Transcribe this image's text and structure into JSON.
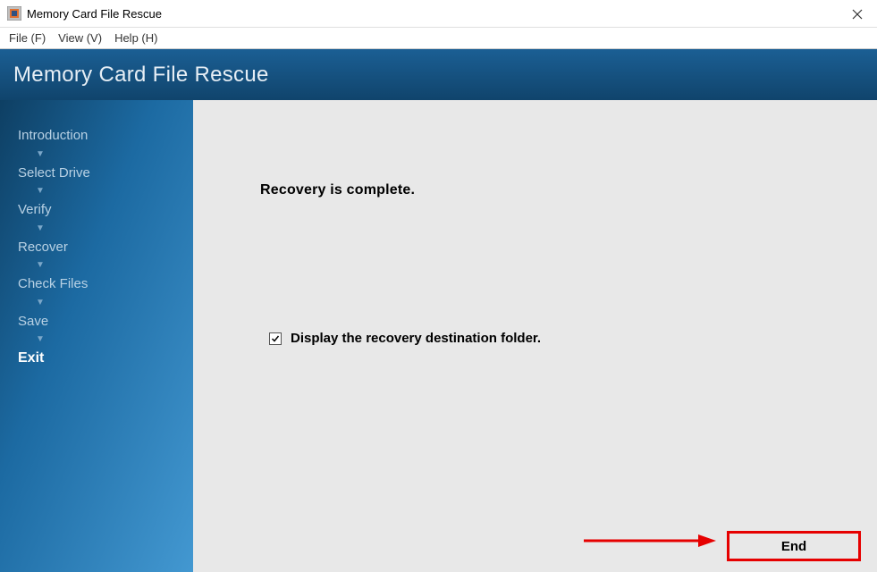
{
  "window": {
    "title": "Memory Card File Rescue"
  },
  "menu": {
    "items": [
      "File (F)",
      "View (V)",
      "Help (H)"
    ]
  },
  "header": {
    "title": "Memory Card File Rescue"
  },
  "sidebar": {
    "steps": [
      "Introduction",
      "Select Drive",
      "Verify",
      "Recover",
      "Check Files",
      "Save",
      "Exit"
    ],
    "active_index": 6
  },
  "main": {
    "status_message": "Recovery is complete.",
    "checkbox": {
      "label": "Display the recovery destination folder.",
      "checked": true
    },
    "end_button_label": "End"
  },
  "annotation": {
    "highlight_color": "#e60000"
  }
}
